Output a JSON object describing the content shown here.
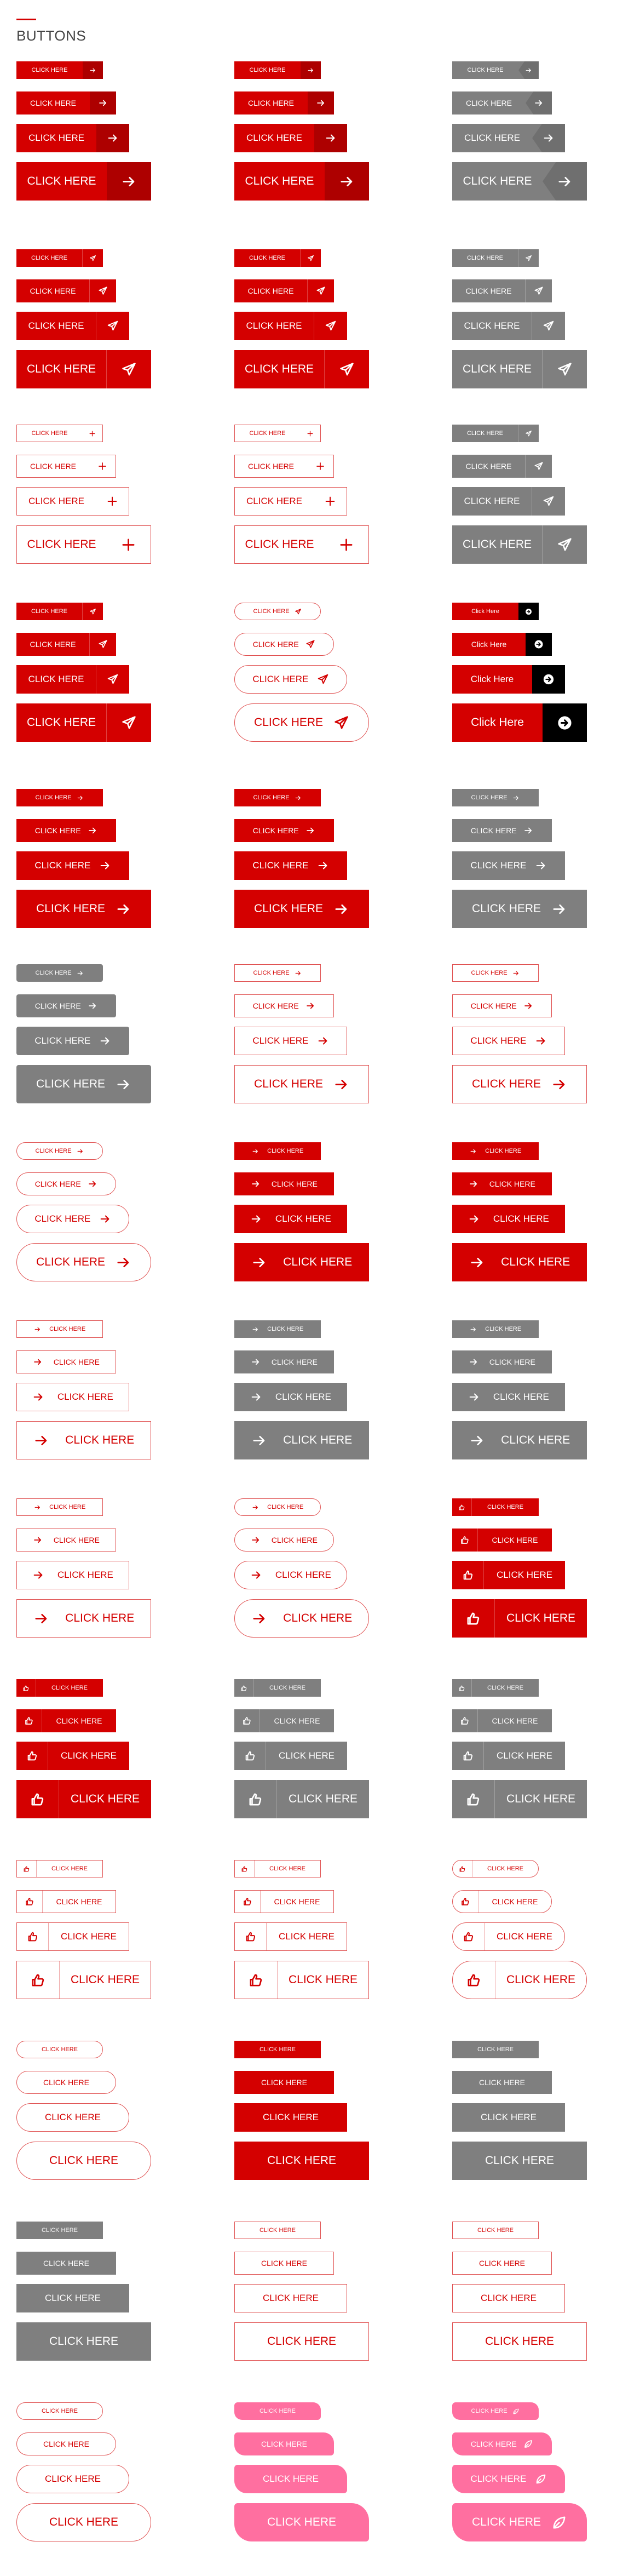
{
  "page": {
    "title": "BUTTONS",
    "accent_color": "#d40000"
  },
  "colors": {
    "red": "#d40000",
    "gray": "#7f7f7f",
    "outline": "#e05252",
    "black": "#000000",
    "pink": "#ff6fa0"
  },
  "labels": {
    "upper": "CLICK HERE",
    "title": "Click Here"
  },
  "groups": [
    {
      "col": 0,
      "row": 0,
      "skin": "red",
      "icon": "arrow-right-icon",
      "layout": "right",
      "iconBox": "dark"
    },
    {
      "col": 1,
      "row": 0,
      "skin": "red",
      "icon": "arrow-right-icon",
      "layout": "right",
      "iconBox": "dark"
    },
    {
      "col": 2,
      "row": 0,
      "skin": "gray",
      "icon": "arrow-right-icon",
      "layout": "right",
      "iconBox": "diag"
    },
    {
      "col": 0,
      "row": 1,
      "skin": "red",
      "icon": "paper-plane-icon",
      "layout": "right",
      "iconBox": "sep"
    },
    {
      "col": 1,
      "row": 1,
      "skin": "red",
      "icon": "paper-plane-icon",
      "layout": "right",
      "iconBox": "sep"
    },
    {
      "col": 2,
      "row": 1,
      "skin": "gray",
      "icon": "paper-plane-icon",
      "layout": "right",
      "iconBox": "sep"
    },
    {
      "col": 0,
      "row": 2,
      "skin": "outline",
      "icon": "plus-icon",
      "layout": "right",
      "iconBox": "none"
    },
    {
      "col": 1,
      "row": 2,
      "skin": "outline",
      "icon": "plus-icon",
      "layout": "right",
      "iconBox": "none"
    },
    {
      "col": 2,
      "row": 2,
      "skin": "gray",
      "icon": "paper-plane-icon",
      "layout": "right",
      "iconBox": "sep"
    },
    {
      "col": 0,
      "row": 3,
      "skin": "red",
      "icon": "paper-plane-icon",
      "layout": "right",
      "iconBox": "sep"
    },
    {
      "col": 1,
      "row": 3,
      "skin": "outline",
      "shape": "pill",
      "icon": "paper-plane-icon",
      "layout": "inline",
      "iconBox": "none"
    },
    {
      "col": 2,
      "row": 3,
      "skin": "black",
      "icon": "circle-arrow-icon",
      "layout": "right",
      "iconBox": "black",
      "textCase": "title"
    },
    {
      "col": 0,
      "row": 4,
      "skin": "red",
      "icon": "arrow-right-icon",
      "layout": "inline",
      "iconBox": "none"
    },
    {
      "col": 1,
      "row": 4,
      "skin": "red",
      "icon": "arrow-right-icon",
      "layout": "inline",
      "iconBox": "none"
    },
    {
      "col": 2,
      "row": 4,
      "skin": "gray",
      "icon": "arrow-right-icon",
      "layout": "inline",
      "iconBox": "none"
    },
    {
      "col": 0,
      "row": 5,
      "skin": "gray",
      "shape": "rnd",
      "icon": "arrow-right-icon",
      "layout": "inline",
      "iconBox": "none"
    },
    {
      "col": 1,
      "row": 5,
      "skin": "outline",
      "icon": "arrow-right-icon",
      "layout": "inline",
      "iconBox": "none"
    },
    {
      "col": 2,
      "row": 5,
      "skin": "outline",
      "icon": "arrow-right-icon",
      "layout": "inline",
      "iconBox": "none"
    },
    {
      "col": 0,
      "row": 6,
      "skin": "outline",
      "shape": "pill",
      "icon": "arrow-right-icon",
      "layout": "inline",
      "iconBox": "none"
    },
    {
      "col": 1,
      "row": 6,
      "skin": "red",
      "icon": "arrow-right-icon",
      "layout": "left",
      "iconBox": "none"
    },
    {
      "col": 2,
      "row": 6,
      "skin": "red",
      "icon": "arrow-right-icon",
      "layout": "left",
      "iconBox": "none"
    },
    {
      "col": 0,
      "row": 7,
      "skin": "outline",
      "icon": "arrow-right-icon",
      "layout": "left",
      "iconBox": "none"
    },
    {
      "col": 1,
      "row": 7,
      "skin": "gray",
      "icon": "arrow-right-icon",
      "layout": "left",
      "iconBox": "none"
    },
    {
      "col": 2,
      "row": 7,
      "skin": "gray",
      "icon": "arrow-right-icon",
      "layout": "left",
      "iconBox": "none"
    },
    {
      "col": 0,
      "row": 8,
      "skin": "outline",
      "icon": "arrow-right-icon",
      "layout": "left",
      "iconBox": "none"
    },
    {
      "col": 1,
      "row": 8,
      "skin": "outline",
      "shape": "pill",
      "icon": "arrow-right-icon",
      "layout": "left",
      "iconBox": "none"
    },
    {
      "col": 2,
      "row": 8,
      "skin": "red",
      "icon": "thumbs-up-icon",
      "layout": "leftbox",
      "iconBox": "sep-light"
    },
    {
      "col": 0,
      "row": 9,
      "skin": "red",
      "icon": "thumbs-up-icon",
      "layout": "leftbox",
      "iconBox": "sep-light"
    },
    {
      "col": 1,
      "row": 9,
      "skin": "gray",
      "icon": "thumbs-up-icon",
      "layout": "leftbox",
      "iconBox": "sep-light"
    },
    {
      "col": 2,
      "row": 9,
      "skin": "gray",
      "icon": "thumbs-up-icon",
      "layout": "leftbox",
      "iconBox": "sep-light"
    },
    {
      "col": 0,
      "row": 10,
      "skin": "outline",
      "icon": "thumbs-up-icon",
      "layout": "leftbox",
      "iconBox": "sep"
    },
    {
      "col": 1,
      "row": 10,
      "skin": "outline",
      "icon": "thumbs-up-icon",
      "layout": "leftbox",
      "iconBox": "sep"
    },
    {
      "col": 2,
      "row": 10,
      "skin": "outline",
      "shape": "pill",
      "icon": "thumbs-up-icon",
      "layout": "leftbox",
      "iconBox": "sep"
    },
    {
      "col": 0,
      "row": 11,
      "skin": "outline",
      "shape": "pill",
      "icon": "none",
      "layout": "plain",
      "iconBox": "none"
    },
    {
      "col": 1,
      "row": 11,
      "skin": "red",
      "icon": "none",
      "layout": "plain",
      "iconBox": "none"
    },
    {
      "col": 2,
      "row": 11,
      "skin": "gray",
      "icon": "none",
      "layout": "plain",
      "iconBox": "none"
    },
    {
      "col": 0,
      "row": 12,
      "skin": "gray",
      "icon": "none",
      "layout": "plain",
      "iconBox": "none"
    },
    {
      "col": 1,
      "row": 12,
      "skin": "outline",
      "icon": "none",
      "layout": "plain",
      "iconBox": "none"
    },
    {
      "col": 2,
      "row": 12,
      "skin": "outline",
      "icon": "none",
      "layout": "plain",
      "iconBox": "none"
    },
    {
      "col": 0,
      "row": 13,
      "skin": "outline",
      "shape": "pill",
      "icon": "none",
      "layout": "plain",
      "iconBox": "none"
    },
    {
      "col": 1,
      "row": 13,
      "skin": "pink",
      "shape": "tab",
      "icon": "none",
      "layout": "plain",
      "iconBox": "none"
    },
    {
      "col": 2,
      "row": 13,
      "skin": "pink",
      "shape": "tab",
      "icon": "leaf-icon",
      "layout": "inline",
      "iconBox": "none"
    }
  ]
}
